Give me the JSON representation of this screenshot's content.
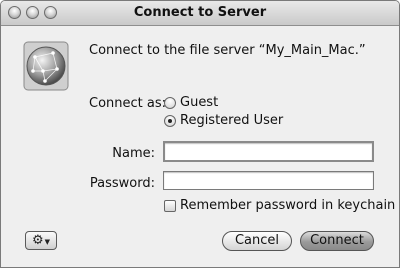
{
  "window": {
    "title": "Connect to Server"
  },
  "message": "Connect to the file server “My_Main_Mac.”",
  "connect_as": {
    "label": "Connect as:",
    "options": [
      {
        "label": "Guest",
        "selected": false
      },
      {
        "label": "Registered User",
        "selected": true
      }
    ]
  },
  "fields": {
    "name_label": "Name:",
    "name_value": "",
    "password_label": "Password:",
    "password_value": ""
  },
  "remember": {
    "label": "Remember password in keychain",
    "checked": false
  },
  "buttons": {
    "action_menu_icon": "gear-icon",
    "cancel": "Cancel",
    "connect": "Connect"
  }
}
